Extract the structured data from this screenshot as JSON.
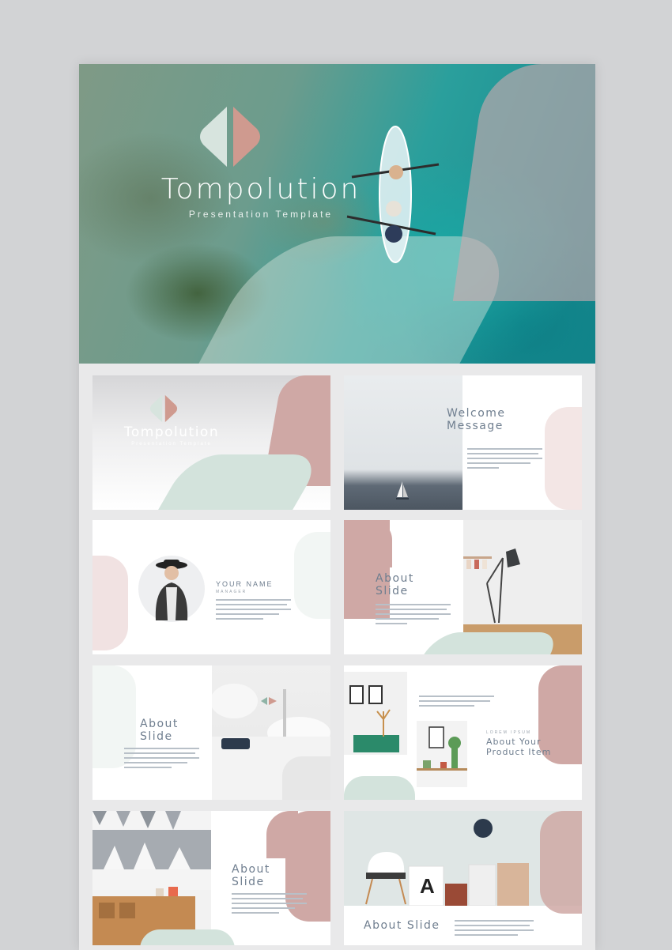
{
  "hero": {
    "title": "Tompolution",
    "subtitle": "Presentation Template"
  },
  "slides": [
    {
      "title": "Tompolution",
      "subtitle": "Presentation Template"
    },
    {
      "title": "Welcome\nMessage"
    },
    {
      "title": "YOUR NAME",
      "subtitle": "MANAGER"
    },
    {
      "title": "About\nSlide"
    },
    {
      "title": "About\nSlide"
    },
    {
      "title": "About Your\nProduct Item",
      "subtitle": "LOREM IPSUM"
    },
    {
      "title": "About\nSlide"
    },
    {
      "title": "About Slide"
    }
  ],
  "colors": {
    "rose": "#cfa8a5",
    "mint": "#d3e3dc",
    "text": "#6f7e8f"
  }
}
